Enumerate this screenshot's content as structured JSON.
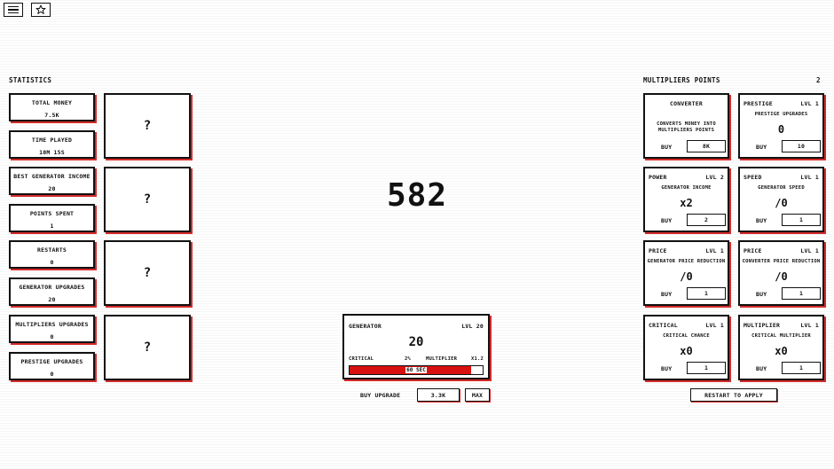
{
  "top": {
    "menu_icon": "hamburger-icon",
    "star_icon": "star-icon"
  },
  "statistics": {
    "title": "STATISTICS",
    "items": [
      {
        "label": "TOTAL MONEY",
        "value": "7.5K"
      },
      {
        "label": "TIME PLAYED",
        "value": "10m 15s"
      },
      {
        "label": "BEST GENERATOR INCOME",
        "value": "20"
      },
      {
        "label": "POINTS SPENT",
        "value": "1"
      },
      {
        "label": "RESTARTS",
        "value": "0"
      },
      {
        "label": "GENERATOR UPGRADES",
        "value": "20"
      },
      {
        "label": "MULTIPLIERS UPGRADES",
        "value": "0"
      },
      {
        "label": "PRESTIGE UPGRADES",
        "value": "0"
      }
    ],
    "mystery": [
      "?",
      "?",
      "?",
      "?"
    ]
  },
  "score": "582",
  "generator": {
    "name": "GENERATOR",
    "level": "LVL 20",
    "count": "20",
    "critical_label": "CRITICAL",
    "critical_value": "2%",
    "multiplier_label": "MULTIPLIER",
    "multiplier_value": "x1.2",
    "progress": 0.91,
    "timer": "60 SEC",
    "buy_label": "BUY UPGRADE",
    "price": "3.3K",
    "max_label": "MAX"
  },
  "multipliers": {
    "title": "MULTIPLIERS POINTS",
    "points": "2",
    "converter": {
      "title": "CONVERTER",
      "desc_line1": "CONVERTS MONEY INTO",
      "desc_line2": "MULTIPLIERS POINTS",
      "buy": "BUY",
      "price": "8K"
    },
    "cards": [
      {
        "title": "PRESTIGE",
        "level": "LVL 1",
        "sub": "PRESTIGE UPGRADES",
        "value": "0",
        "buy": "BUY",
        "price": "10"
      },
      {
        "title": "POWER",
        "level": "LVL 2",
        "sub": "GENERATOR INCOME",
        "value": "x2",
        "buy": "BUY",
        "price": "2"
      },
      {
        "title": "SPEED",
        "level": "LVL 1",
        "sub": "GENERATOR SPEED",
        "value": "/0",
        "buy": "BUY",
        "price": "1"
      },
      {
        "title": "PRICE",
        "level": "LVL 1",
        "sub": "GENERATOR PRICE REDUCTION",
        "value": "/0",
        "buy": "BUY",
        "price": "1"
      },
      {
        "title": "PRICE",
        "level": "LVL 1",
        "sub": "CONVERTER PRICE REDUCTION",
        "value": "/0",
        "buy": "BUY",
        "price": "1"
      },
      {
        "title": "CRITICAL",
        "level": "LVL 1",
        "sub": "CRITICAL CHANCE",
        "value": "x0",
        "buy": "BUY",
        "price": "1"
      },
      {
        "title": "MULTIPLIER",
        "level": "LVL 1",
        "sub": "CRITICAL MULTIPLIER",
        "value": "x0",
        "buy": "BUY",
        "price": "1"
      }
    ],
    "restart_label": "RESTART TO APPLY"
  },
  "colors": {
    "accent": "#d91010",
    "ink": "#111111"
  }
}
